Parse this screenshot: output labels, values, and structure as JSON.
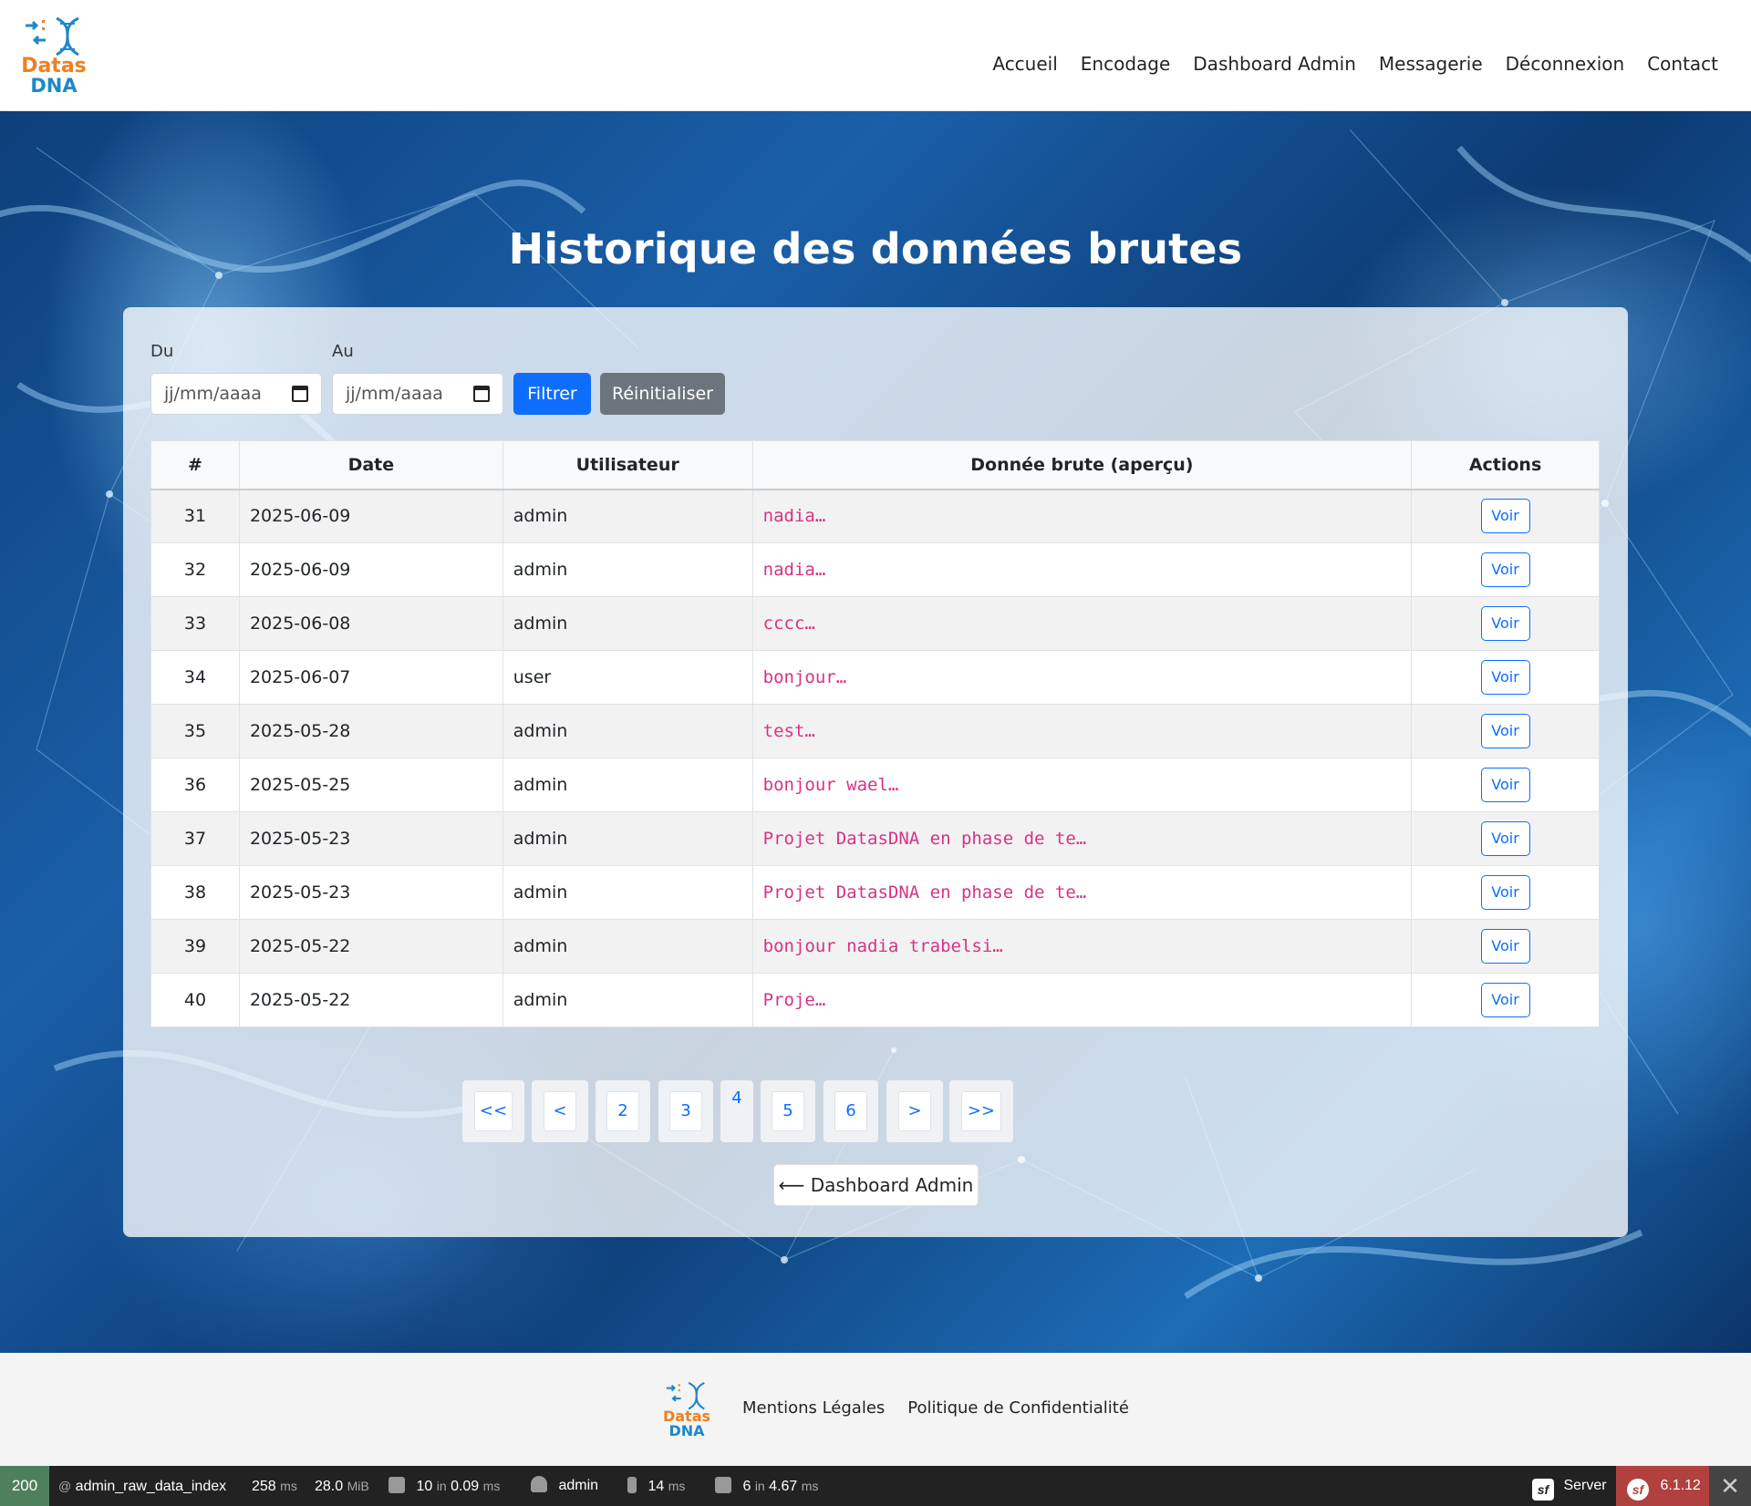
{
  "header": {
    "logo": {
      "line1": "Datas",
      "line2": "DNA"
    },
    "nav": [
      "Accueil",
      "Encodage",
      "Dashboard Admin",
      "Messagerie",
      "Déconnexion",
      "Contact"
    ]
  },
  "page": {
    "title": "Historique des données brutes",
    "filter": {
      "from_label": "Du",
      "to_label": "Au",
      "from_placeholder": "jj/mm/aaaa",
      "to_placeholder": "jj/mm/aaaa",
      "filter_button": "Filtrer",
      "reset_button": "Réinitialiser"
    },
    "table": {
      "columns": [
        "#",
        "Date",
        "Utilisateur",
        "Donnée brute (aperçu)",
        "Actions"
      ],
      "action_label": "Voir",
      "rows": [
        {
          "id": "31",
          "date": "2025-06-09",
          "user": "admin",
          "raw": "nadia…"
        },
        {
          "id": "32",
          "date": "2025-06-09",
          "user": "admin",
          "raw": "nadia…"
        },
        {
          "id": "33",
          "date": "2025-06-08",
          "user": "admin",
          "raw": "cccc…"
        },
        {
          "id": "34",
          "date": "2025-06-07",
          "user": "user",
          "raw": "bonjour…"
        },
        {
          "id": "35",
          "date": "2025-05-28",
          "user": "admin",
          "raw": "test…"
        },
        {
          "id": "36",
          "date": "2025-05-25",
          "user": "admin",
          "raw": "bonjour wael…"
        },
        {
          "id": "37",
          "date": "2025-05-23",
          "user": "admin",
          "raw": "Projet DatasDNA en phase de te…"
        },
        {
          "id": "38",
          "date": "2025-05-23",
          "user": "admin",
          "raw": "Projet DatasDNA en phase de te…"
        },
        {
          "id": "39",
          "date": "2025-05-22",
          "user": "admin",
          "raw": "bonjour nadia trabelsi…"
        },
        {
          "id": "40",
          "date": "2025-05-22",
          "user": "admin",
          "raw": "Proje…"
        }
      ]
    },
    "pagination": {
      "items": [
        "<<",
        "<",
        "2",
        "3",
        "4",
        "5",
        "6",
        ">",
        ">>"
      ],
      "current": "4"
    },
    "back_button": "⟵ Dashboard Admin"
  },
  "footer": {
    "logo": {
      "line1": "Datas",
      "line2": "DNA"
    },
    "links": [
      "Mentions Légales",
      "Politique de Confidentialité"
    ]
  },
  "debug_toolbar": {
    "status": "200",
    "route": "admin_raw_data_index",
    "time_value": "258",
    "time_unit": "ms",
    "memory_value": "28.0",
    "memory_unit": "MiB",
    "forms_value": "10",
    "forms_in": "in",
    "forms_time": "0.09",
    "forms_unit": "ms",
    "user": "admin",
    "render_value": "14",
    "render_unit": "ms",
    "db_value": "6",
    "db_in": "in",
    "db_time": "4.67",
    "db_unit": "ms",
    "server_label": "Server",
    "version": "6.1.12",
    "colors": {
      "status_ok": "#4f805d",
      "version_bg": "#b0413e"
    }
  },
  "colors": {
    "primary": "#0d6efd",
    "secondary": "#6c757d",
    "code_pink": "#d63384",
    "logo_orange": "#f07f1e",
    "logo_blue": "#1e88c8"
  }
}
